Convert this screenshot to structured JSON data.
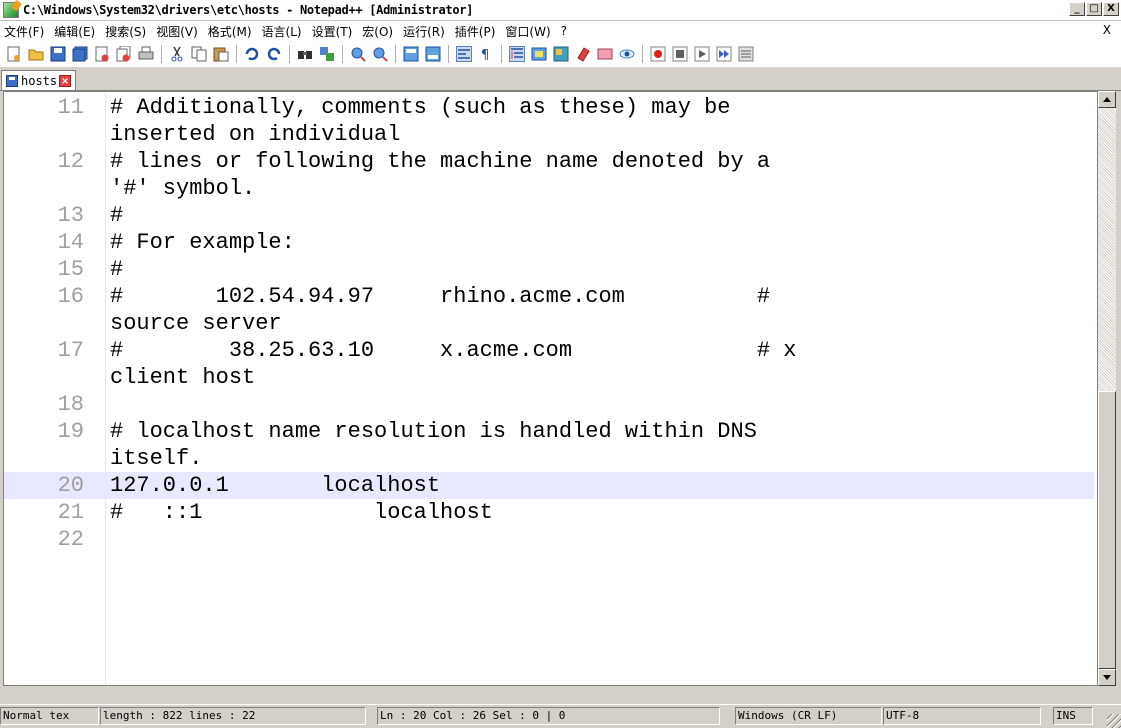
{
  "window": {
    "title": "C:\\Windows\\System32\\drivers\\etc\\hosts - Notepad++ [Administrator]",
    "min_label": "_",
    "max_label": "□",
    "close_label": "X"
  },
  "menu": {
    "items": [
      "文件(F)",
      "编辑(E)",
      "搜索(S)",
      "视图(V)",
      "格式(M)",
      "语言(L)",
      "设置(T)",
      "宏(O)",
      "运行(R)",
      "插件(P)",
      "窗口(W)",
      "?"
    ],
    "close_label": "X"
  },
  "toolbar": {
    "icons": [
      "new-file-icon",
      "open-file-icon",
      "save-icon",
      "save-all-icon",
      "close-icon",
      "close-all-icon",
      "print-icon",
      "cut-icon",
      "copy-icon",
      "paste-icon",
      "undo-icon",
      "redo-icon",
      "find-icon",
      "replace-icon",
      "zoom-in-icon",
      "zoom-out-icon",
      "sync-vertical-icon",
      "sync-horizontal-icon",
      "word-wrap-icon",
      "show-all-chars-icon",
      "indent-guide-icon",
      "doc-map-icon",
      "function-list-icon",
      "folder-workspace-icon",
      "monitor-icon",
      "record-macro-icon",
      "stop-macro-icon",
      "play-macro-icon",
      "run-macro-multiple-icon",
      "save-macro-icon"
    ]
  },
  "tabs": [
    {
      "label": "hosts",
      "close_label": "×"
    }
  ],
  "editor": {
    "lines": [
      {
        "n": "11",
        "text": "# Additionally, comments (such as these) may be",
        "current": false
      },
      {
        "n": "",
        "text": "inserted on individual",
        "current": false
      },
      {
        "n": "12",
        "text": "# lines or following the machine name denoted by a",
        "current": false
      },
      {
        "n": "",
        "text": "'#' symbol.",
        "current": false
      },
      {
        "n": "13",
        "text": "#",
        "current": false
      },
      {
        "n": "14",
        "text": "# For example:",
        "current": false
      },
      {
        "n": "15",
        "text": "#",
        "current": false
      },
      {
        "n": "16",
        "text": "#       102.54.94.97     rhino.acme.com          #",
        "current": false
      },
      {
        "n": "",
        "text": "source server",
        "current": false
      },
      {
        "n": "17",
        "text": "#        38.25.63.10     x.acme.com              # x",
        "current": false
      },
      {
        "n": "",
        "text": "client host",
        "current": false
      },
      {
        "n": "18",
        "text": "",
        "current": false
      },
      {
        "n": "19",
        "text": "# localhost name resolution is handled within DNS",
        "current": false
      },
      {
        "n": "",
        "text": "itself.",
        "current": false
      },
      {
        "n": "20",
        "text": "127.0.0.1       localhost",
        "current": true
      },
      {
        "n": "21",
        "text": "#   ::1             localhost",
        "current": false
      },
      {
        "n": "22",
        "text": "",
        "current": false
      }
    ]
  },
  "status": {
    "type": "Normal tex",
    "length": "length : 822    lines : 22",
    "position": "Ln : 20    Col : 26    Sel : 0 | 0",
    "eol": "Windows (CR LF)",
    "encoding": "UTF-8",
    "mode": "INS"
  }
}
